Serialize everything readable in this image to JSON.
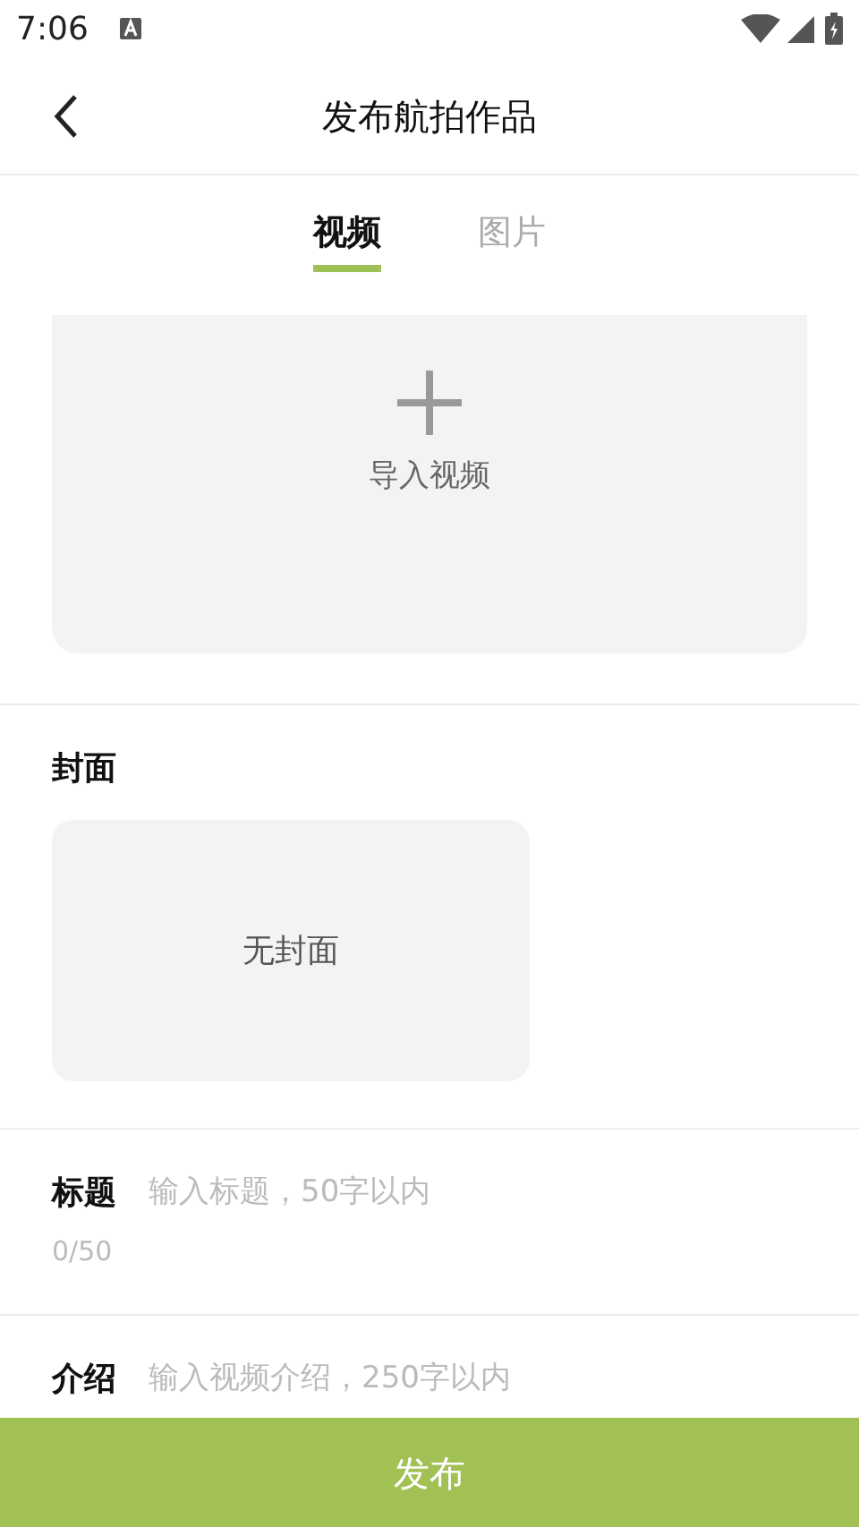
{
  "status_bar": {
    "time": "7:06"
  },
  "header": {
    "title": "发布航拍作品"
  },
  "tabs": [
    {
      "label": "视频",
      "selected": true
    },
    {
      "label": "图片",
      "selected": false
    }
  ],
  "upload": {
    "label": "导入视频"
  },
  "cover": {
    "heading": "封面",
    "placeholder_text": "无封面"
  },
  "fields": [
    {
      "label": "标题",
      "placeholder": "输入标题，50字以内",
      "counter": "0/50"
    },
    {
      "label": "介绍",
      "placeholder": "输入视频介绍，250字以内"
    }
  ],
  "publish_button": {
    "label": "发布"
  }
}
